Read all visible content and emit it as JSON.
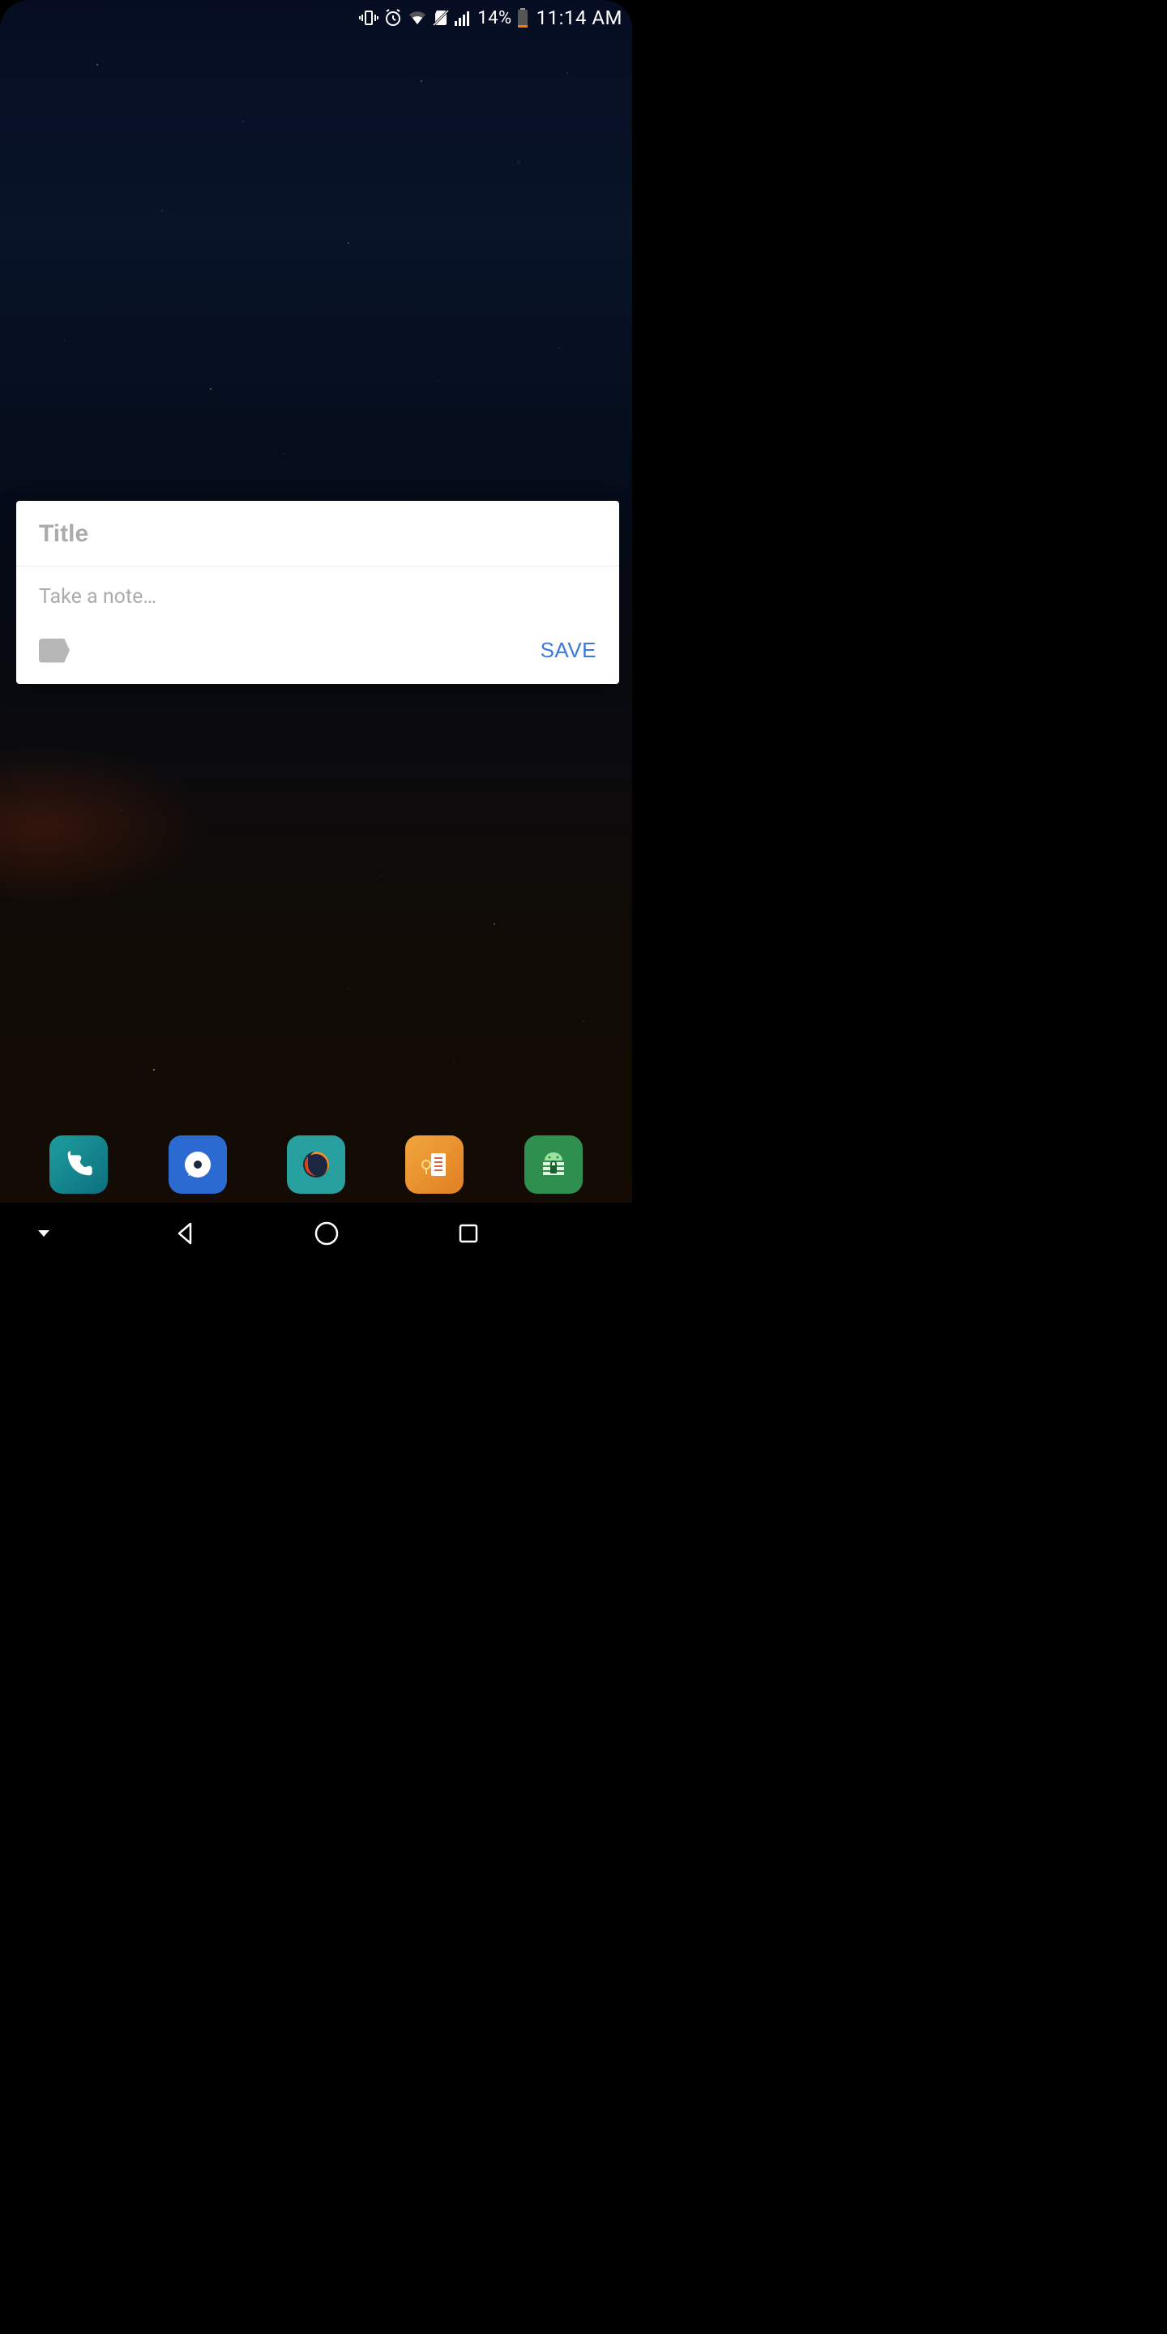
{
  "status_bar": {
    "battery_pct": "14%",
    "time": "11:14 AM"
  },
  "note_card": {
    "title_placeholder": "Title",
    "title_value": "",
    "body_placeholder": "Take a note…",
    "body_value": "",
    "save_label": "SAVE"
  },
  "dock": {
    "items": [
      {
        "name": "phone"
      },
      {
        "name": "signal"
      },
      {
        "name": "firefox"
      },
      {
        "name": "notes"
      },
      {
        "name": "android-privacy"
      }
    ]
  }
}
